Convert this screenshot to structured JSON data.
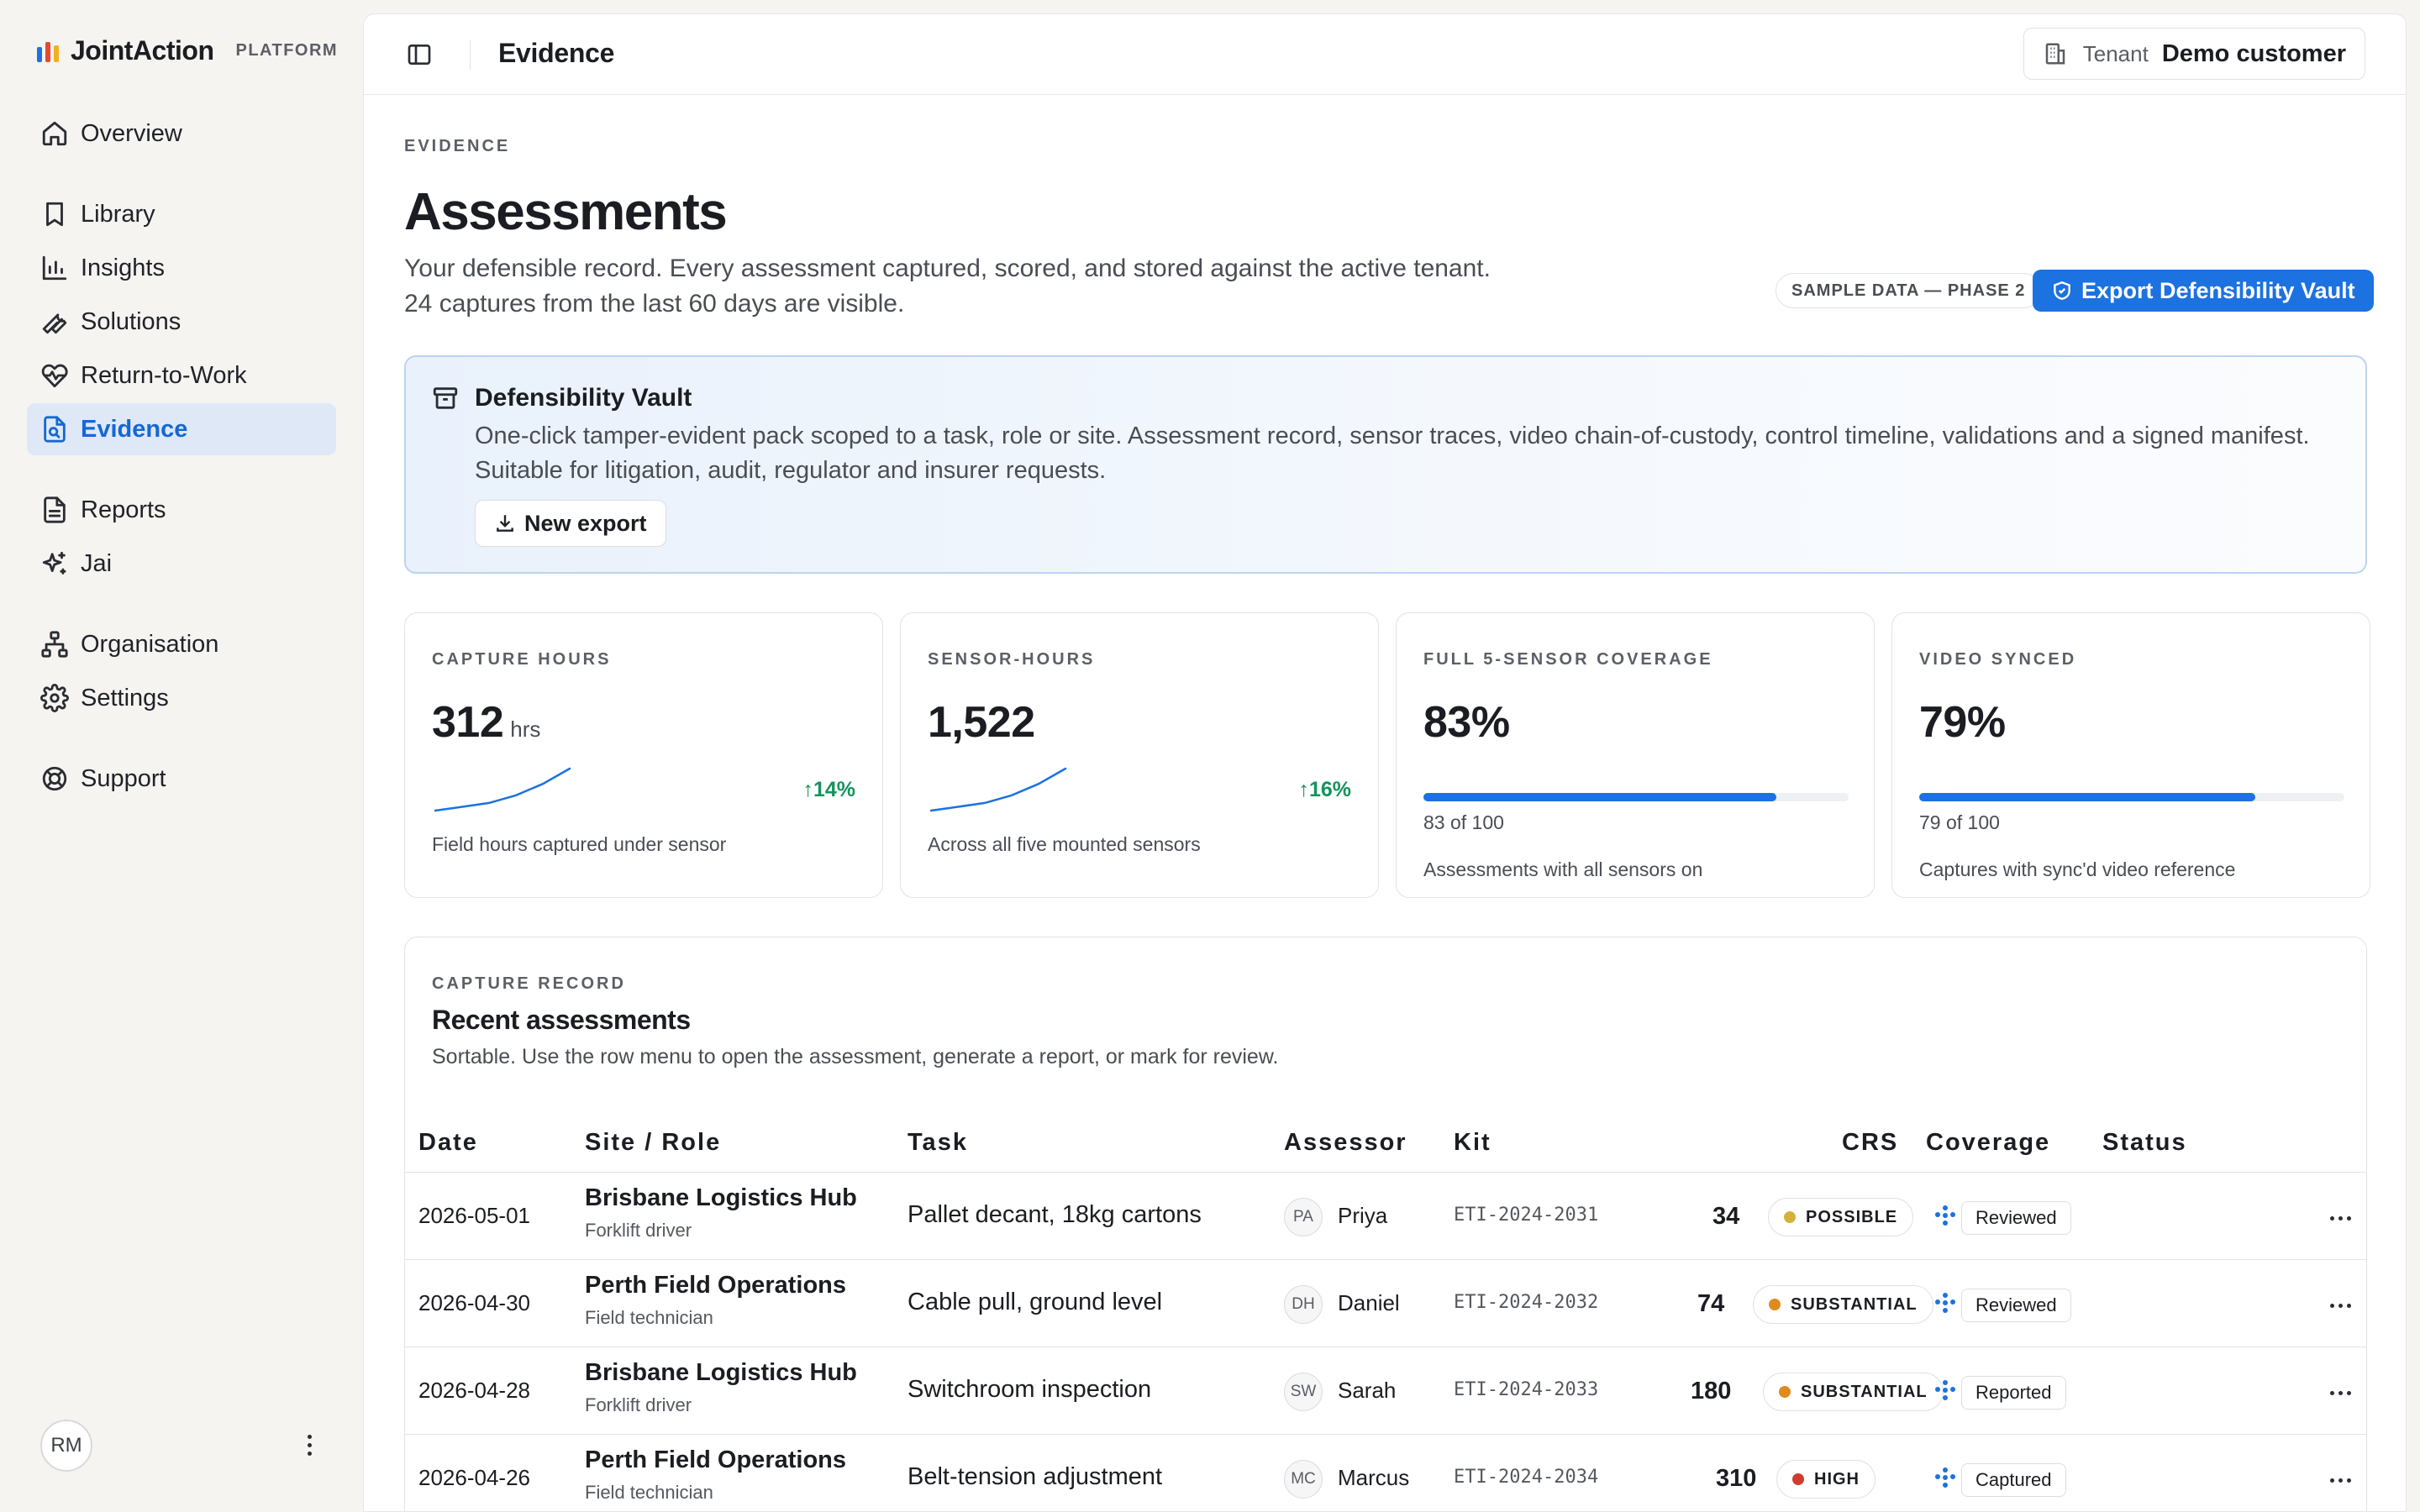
{
  "brand": {
    "name": "JointAction",
    "tag": "PLATFORM"
  },
  "nav": [
    {
      "label": "Overview",
      "icon": "home-icon"
    },
    {
      "label": "Library",
      "icon": "bookmark-icon"
    },
    {
      "label": "Insights",
      "icon": "bar-chart-icon"
    },
    {
      "label": "Solutions",
      "icon": "wrench-icon"
    },
    {
      "label": "Return-to-Work",
      "icon": "heart-pulse-icon"
    },
    {
      "label": "Evidence",
      "icon": "file-search-icon",
      "active": true
    },
    {
      "label": "Reports",
      "icon": "document-icon"
    },
    {
      "label": "Jai",
      "icon": "sparkles-icon"
    },
    {
      "label": "Organisation",
      "icon": "org-chart-icon"
    },
    {
      "label": "Settings",
      "icon": "gear-icon"
    },
    {
      "label": "Support",
      "icon": "lifebuoy-icon"
    }
  ],
  "user": {
    "initials": "RM"
  },
  "topbar": {
    "title": "Evidence",
    "tenant_label": "Tenant",
    "tenant_value": "Demo customer"
  },
  "page": {
    "eyebrow": "EVIDENCE",
    "title": "Assessments",
    "desc_line1": "Your defensible record. Every assessment captured, scored, and stored against the active tenant.",
    "desc_line2": "24 captures from the last 60 days are visible.",
    "sample_badge": "SAMPLE DATA — PHASE 2",
    "export_button": "Export Defensibility Vault"
  },
  "vault": {
    "title": "Defensibility Vault",
    "desc": "One-click tamper-evident pack scoped to a task, role or site. Assessment record, sensor traces, video chain-of-custody, control timeline, validations and a signed manifest. Suitable for litigation, audit, regulator and insurer requests.",
    "button": "New export"
  },
  "stats": {
    "capture_hours": {
      "label": "CAPTURE HOURS",
      "value": "312",
      "unit": "hrs",
      "trend": "↑14%",
      "foot": "Field hours captured under sensor",
      "spark": [
        2,
        3,
        4,
        6,
        9,
        13
      ]
    },
    "sensor_hours": {
      "label": "SENSOR-HOURS",
      "value": "1,522",
      "trend": "↑16%",
      "foot": "Across all five mounted sensors",
      "spark": [
        2,
        3,
        4,
        6,
        9,
        13
      ]
    },
    "coverage": {
      "label": "FULL 5-SENSOR COVERAGE",
      "value": "83%",
      "fraction": 0.83,
      "count": "83 of 100",
      "foot": "Assessments with all sensors on"
    },
    "video": {
      "label": "VIDEO SYNCED",
      "value": "79%",
      "fraction": 0.79,
      "count": "79 of 100",
      "foot": "Captures with sync'd video reference"
    }
  },
  "record": {
    "eyebrow": "CAPTURE RECORD",
    "title": "Recent assessments",
    "desc": "Sortable. Use the row menu to open the assessment, generate a report, or mark for review.",
    "columns": {
      "date": "Date",
      "site": "Site / Role",
      "task": "Task",
      "assessor": "Assessor",
      "kit": "Kit",
      "crs": "CRS",
      "coverage": "Coverage",
      "status": "Status"
    },
    "rows": [
      {
        "date": "2026-05-01",
        "site": "Brisbane Logistics Hub",
        "role": "Forklift driver",
        "task": "Pallet decant, 18kg cartons",
        "initials": "PA",
        "assessor": "Priya",
        "kit": "ETI-2024-2031",
        "crs": "34",
        "risk": "POSSIBLE",
        "risk_color": "#d4b23a",
        "status": "Reviewed"
      },
      {
        "date": "2026-04-30",
        "site": "Perth Field Operations",
        "role": "Field technician",
        "task": "Cable pull, ground level",
        "initials": "DH",
        "assessor": "Daniel",
        "kit": "ETI-2024-2032",
        "crs": "74",
        "risk": "SUBSTANTIAL",
        "risk_color": "#e08a1e",
        "status": "Reviewed"
      },
      {
        "date": "2026-04-28",
        "site": "Brisbane Logistics Hub",
        "role": "Forklift driver",
        "task": "Switchroom inspection",
        "initials": "SW",
        "assessor": "Sarah",
        "kit": "ETI-2024-2033",
        "crs": "180",
        "risk": "SUBSTANTIAL",
        "risk_color": "#e08a1e",
        "status": "Reported"
      },
      {
        "date": "2026-04-26",
        "site": "Perth Field Operations",
        "role": "Field technician",
        "task": "Belt-tension adjustment",
        "initials": "MC",
        "assessor": "Marcus",
        "kit": "ETI-2024-2034",
        "crs": "310",
        "risk": "HIGH",
        "risk_color": "#d13b2c",
        "status": "Captured"
      }
    ]
  },
  "colors": {
    "accent": "#1c72e0",
    "trend_up": "#15935b",
    "active_nav_bg": "#dfe8f7",
    "coverage_dots": "#1c72e0"
  }
}
